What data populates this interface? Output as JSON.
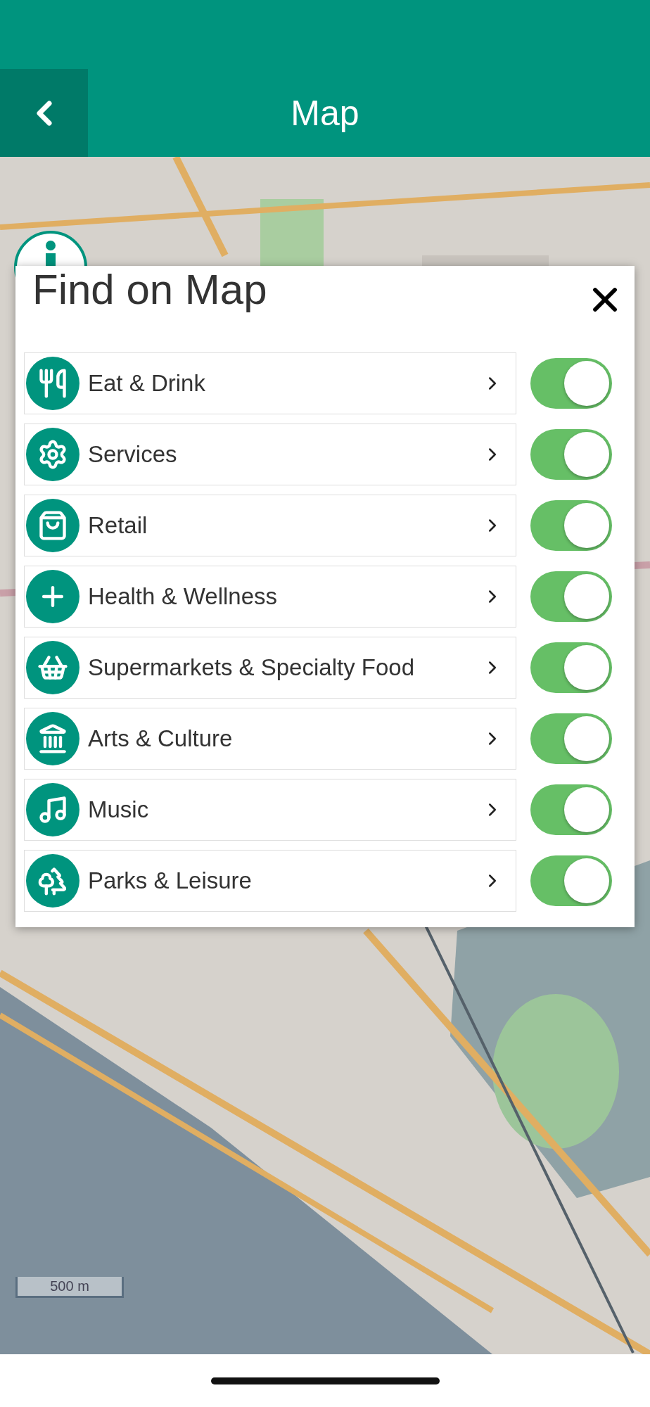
{
  "header": {
    "title": "Map"
  },
  "map": {
    "kind": "picture",
    "scale": "500 m"
  },
  "dialog": {
    "title": "Find on Map",
    "categories": [
      {
        "label": "Eat & Drink",
        "on": true
      },
      {
        "label": "Services",
        "on": true
      },
      {
        "label": "Retail",
        "on": true
      },
      {
        "label": "Health & Wellness",
        "on": true
      },
      {
        "label": "Supermarkets & Specialty Food",
        "on": true
      },
      {
        "label": "Arts & Culture",
        "on": true
      },
      {
        "label": "Music",
        "on": true
      },
      {
        "label": "Parks & Leisure",
        "on": true
      }
    ]
  }
}
